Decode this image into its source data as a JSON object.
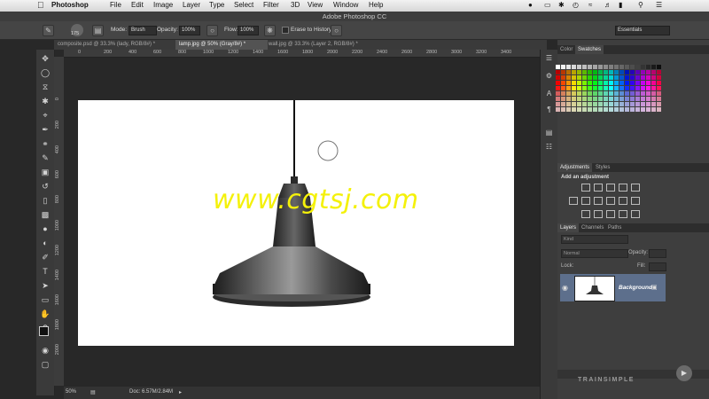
{
  "menubar": {
    "app_name": "Photoshop",
    "menus": [
      "File",
      "Edit",
      "Image",
      "Layer",
      "Type",
      "Select",
      "Filter",
      "3D",
      "View",
      "Window",
      "Help"
    ]
  },
  "window_title": "Adobe Photoshop CC",
  "options_bar": {
    "brush_size": "175",
    "mode_label": "Mode:",
    "mode_value": "Brush",
    "opacity_label": "Opacity:",
    "opacity_value": "100%",
    "flow_label": "Flow:",
    "flow_value": "100%",
    "erase_to_history": "Erase to History",
    "workspace": "Essentials"
  },
  "tabs": [
    {
      "label": "composite.psd @ 33.3% (lady, RGB/8#) *"
    },
    {
      "label": "lamp.jpg @ 50% (Gray/8#) *"
    },
    {
      "label": "wall.jpg @ 33.3% (Layer 2, RGB/8#) *"
    }
  ],
  "ruler": {
    "h": [
      "200",
      "400",
      "600",
      "800",
      "1000",
      "1200",
      "1400",
      "1600",
      "1800",
      "2000",
      "2200",
      "2400",
      "2600",
      "2800",
      "3000",
      "3200",
      "3400"
    ],
    "h_start": "0",
    "v": [
      "0",
      "200",
      "400",
      "600",
      "800",
      "1000",
      "1200",
      "1400",
      "1600",
      "1800",
      "2000"
    ]
  },
  "canvas": {
    "watermark": "www.cgtsj.com"
  },
  "status": {
    "zoom": "50%",
    "doc": "Doc: 6.57M/2.84M"
  },
  "panels": {
    "color_tabs": [
      "Color",
      "Swatches"
    ],
    "adjust_tabs": [
      "Adjustments",
      "Styles"
    ],
    "adjust_title": "Add an adjustment",
    "layer_tabs": [
      "Layers",
      "Channels",
      "Paths"
    ],
    "kind": "Kind",
    "blend": "Normal",
    "opacity_label": "Opacity:",
    "lock_label": "Lock:",
    "fill_label": "Fill:",
    "layer_name": "Background"
  },
  "brand": "TRAINSIMPLE",
  "colors": {
    "highlight_layer": "#5d6f8c",
    "watermark": "#f4f10a"
  }
}
